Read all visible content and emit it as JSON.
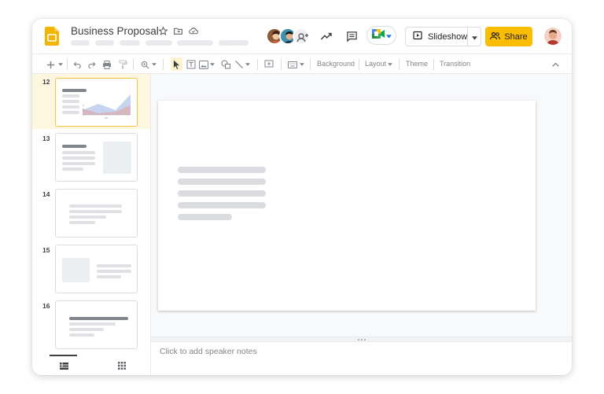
{
  "window": {
    "doc_title": "Business Proposal",
    "icons": [
      "star-icon",
      "move-to-folder-icon",
      "cloud-saved-icon"
    ]
  },
  "header": {
    "collaborators": [
      "collaborator-avatar-1",
      "collaborator-avatar-2",
      "collaborator-more-avatar"
    ],
    "activity_icon": "trending-up-icon",
    "comments_icon": "comment-icon",
    "meet_icon": "google-meet-icon",
    "slideshow_label": "Slideshow",
    "share_label": "Share",
    "accent_color": "#fbbc04"
  },
  "toolbar": {
    "background_label": "Background",
    "layout_label": "Layout",
    "theme_label": "Theme",
    "transition_label": "Transition"
  },
  "filmstrip": {
    "slides": [
      {
        "number": "12",
        "selected": true
      },
      {
        "number": "13",
        "selected": false
      },
      {
        "number": "14",
        "selected": false
      },
      {
        "number": "15",
        "selected": false
      },
      {
        "number": "16",
        "selected": false
      }
    ],
    "selected_color": "#fef7e0"
  },
  "notes": {
    "placeholder": "Click to add speaker notes"
  }
}
